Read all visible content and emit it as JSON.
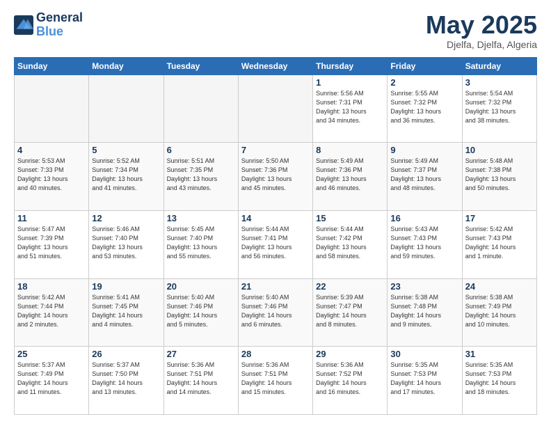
{
  "header": {
    "logo_line1": "General",
    "logo_line2": "Blue",
    "month": "May 2025",
    "location": "Djelfa, Djelfa, Algeria"
  },
  "weekdays": [
    "Sunday",
    "Monday",
    "Tuesday",
    "Wednesday",
    "Thursday",
    "Friday",
    "Saturday"
  ],
  "weeks": [
    [
      {
        "day": "",
        "info": ""
      },
      {
        "day": "",
        "info": ""
      },
      {
        "day": "",
        "info": ""
      },
      {
        "day": "",
        "info": ""
      },
      {
        "day": "1",
        "info": "Sunrise: 5:56 AM\nSunset: 7:31 PM\nDaylight: 13 hours\nand 34 minutes."
      },
      {
        "day": "2",
        "info": "Sunrise: 5:55 AM\nSunset: 7:32 PM\nDaylight: 13 hours\nand 36 minutes."
      },
      {
        "day": "3",
        "info": "Sunrise: 5:54 AM\nSunset: 7:32 PM\nDaylight: 13 hours\nand 38 minutes."
      }
    ],
    [
      {
        "day": "4",
        "info": "Sunrise: 5:53 AM\nSunset: 7:33 PM\nDaylight: 13 hours\nand 40 minutes."
      },
      {
        "day": "5",
        "info": "Sunrise: 5:52 AM\nSunset: 7:34 PM\nDaylight: 13 hours\nand 41 minutes."
      },
      {
        "day": "6",
        "info": "Sunrise: 5:51 AM\nSunset: 7:35 PM\nDaylight: 13 hours\nand 43 minutes."
      },
      {
        "day": "7",
        "info": "Sunrise: 5:50 AM\nSunset: 7:36 PM\nDaylight: 13 hours\nand 45 minutes."
      },
      {
        "day": "8",
        "info": "Sunrise: 5:49 AM\nSunset: 7:36 PM\nDaylight: 13 hours\nand 46 minutes."
      },
      {
        "day": "9",
        "info": "Sunrise: 5:49 AM\nSunset: 7:37 PM\nDaylight: 13 hours\nand 48 minutes."
      },
      {
        "day": "10",
        "info": "Sunrise: 5:48 AM\nSunset: 7:38 PM\nDaylight: 13 hours\nand 50 minutes."
      }
    ],
    [
      {
        "day": "11",
        "info": "Sunrise: 5:47 AM\nSunset: 7:39 PM\nDaylight: 13 hours\nand 51 minutes."
      },
      {
        "day": "12",
        "info": "Sunrise: 5:46 AM\nSunset: 7:40 PM\nDaylight: 13 hours\nand 53 minutes."
      },
      {
        "day": "13",
        "info": "Sunrise: 5:45 AM\nSunset: 7:40 PM\nDaylight: 13 hours\nand 55 minutes."
      },
      {
        "day": "14",
        "info": "Sunrise: 5:44 AM\nSunset: 7:41 PM\nDaylight: 13 hours\nand 56 minutes."
      },
      {
        "day": "15",
        "info": "Sunrise: 5:44 AM\nSunset: 7:42 PM\nDaylight: 13 hours\nand 58 minutes."
      },
      {
        "day": "16",
        "info": "Sunrise: 5:43 AM\nSunset: 7:43 PM\nDaylight: 13 hours\nand 59 minutes."
      },
      {
        "day": "17",
        "info": "Sunrise: 5:42 AM\nSunset: 7:43 PM\nDaylight: 14 hours\nand 1 minute."
      }
    ],
    [
      {
        "day": "18",
        "info": "Sunrise: 5:42 AM\nSunset: 7:44 PM\nDaylight: 14 hours\nand 2 minutes."
      },
      {
        "day": "19",
        "info": "Sunrise: 5:41 AM\nSunset: 7:45 PM\nDaylight: 14 hours\nand 4 minutes."
      },
      {
        "day": "20",
        "info": "Sunrise: 5:40 AM\nSunset: 7:46 PM\nDaylight: 14 hours\nand 5 minutes."
      },
      {
        "day": "21",
        "info": "Sunrise: 5:40 AM\nSunset: 7:46 PM\nDaylight: 14 hours\nand 6 minutes."
      },
      {
        "day": "22",
        "info": "Sunrise: 5:39 AM\nSunset: 7:47 PM\nDaylight: 14 hours\nand 8 minutes."
      },
      {
        "day": "23",
        "info": "Sunrise: 5:38 AM\nSunset: 7:48 PM\nDaylight: 14 hours\nand 9 minutes."
      },
      {
        "day": "24",
        "info": "Sunrise: 5:38 AM\nSunset: 7:49 PM\nDaylight: 14 hours\nand 10 minutes."
      }
    ],
    [
      {
        "day": "25",
        "info": "Sunrise: 5:37 AM\nSunset: 7:49 PM\nDaylight: 14 hours\nand 11 minutes."
      },
      {
        "day": "26",
        "info": "Sunrise: 5:37 AM\nSunset: 7:50 PM\nDaylight: 14 hours\nand 13 minutes."
      },
      {
        "day": "27",
        "info": "Sunrise: 5:36 AM\nSunset: 7:51 PM\nDaylight: 14 hours\nand 14 minutes."
      },
      {
        "day": "28",
        "info": "Sunrise: 5:36 AM\nSunset: 7:51 PM\nDaylight: 14 hours\nand 15 minutes."
      },
      {
        "day": "29",
        "info": "Sunrise: 5:36 AM\nSunset: 7:52 PM\nDaylight: 14 hours\nand 16 minutes."
      },
      {
        "day": "30",
        "info": "Sunrise: 5:35 AM\nSunset: 7:53 PM\nDaylight: 14 hours\nand 17 minutes."
      },
      {
        "day": "31",
        "info": "Sunrise: 5:35 AM\nSunset: 7:53 PM\nDaylight: 14 hours\nand 18 minutes."
      }
    ]
  ]
}
